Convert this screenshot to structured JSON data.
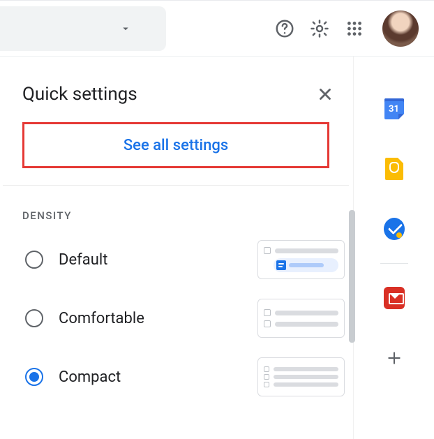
{
  "topbar": {
    "search_dropdown": "▾",
    "help_icon": "help-icon",
    "settings_icon": "settings-gear-icon",
    "apps_icon": "apps-grid-icon",
    "avatar_alt": "Account avatar"
  },
  "panel": {
    "title": "Quick settings",
    "see_all_label": "See all settings",
    "density_section_label": "DENSITY",
    "density_options": [
      {
        "label": "Default",
        "selected": false
      },
      {
        "label": "Comfortable",
        "selected": false
      },
      {
        "label": "Compact",
        "selected": true
      }
    ]
  },
  "sidepanel": {
    "calendar_day": "31",
    "items": [
      "calendar",
      "keep",
      "tasks",
      "offline",
      "add"
    ]
  }
}
